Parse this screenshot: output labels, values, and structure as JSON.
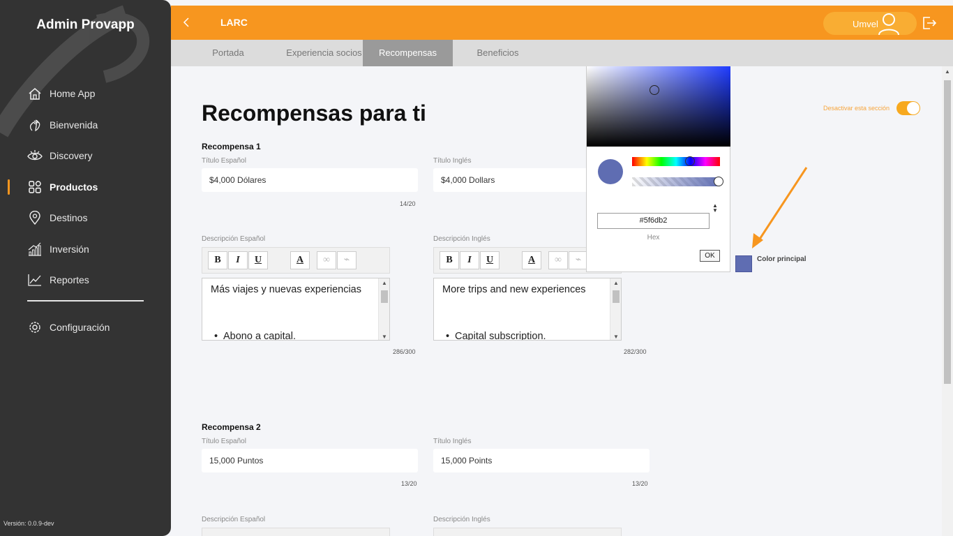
{
  "sidebar": {
    "brand": "Admin Provapp",
    "items": [
      {
        "label": "Home App",
        "icon": "home-icon"
      },
      {
        "label": "Bienvenida",
        "icon": "waving-hand-icon"
      },
      {
        "label": "Discovery",
        "icon": "eye-icon"
      },
      {
        "label": "Productos",
        "icon": "grid-icon",
        "active": true
      },
      {
        "label": "Destinos",
        "icon": "location-pin-icon"
      },
      {
        "label": "Inversión",
        "icon": "bar-growth-icon"
      },
      {
        "label": "Reportes",
        "icon": "line-chart-icon"
      }
    ],
    "config_label": "Configuración",
    "version": "Versión: 0.0.9-dev"
  },
  "header": {
    "title": "LARC",
    "user_name": "Umvel"
  },
  "tabs": [
    {
      "label": "Portada"
    },
    {
      "label": "Experiencia socios"
    },
    {
      "label": "Recompensas",
      "active": true
    },
    {
      "label": "Beneficios"
    }
  ],
  "main": {
    "title": "Recompensas para ti",
    "toggle_label": "Desactivar esta sección",
    "reward1": {
      "title": "Recompensa 1",
      "title_es_label": "Título Español",
      "title_es_value": "$4,000 Dólares",
      "title_es_counter": "14/20",
      "title_en_label": "Título Inglés",
      "title_en_value": "$4,000 Dollars",
      "desc_es_label": "Descripción Español",
      "desc_es_text": "Más viajes y nuevas experiencias",
      "desc_es_bullet": "Abono a capital.",
      "desc_es_counter": "286/300",
      "desc_en_label": "Descripción Inglés",
      "desc_en_text": "More trips and new experiences",
      "desc_en_bullet": "Capital subscription.",
      "desc_en_counter": "282/300"
    },
    "reward2": {
      "title": "Recompensa 2",
      "title_es_label": "Título Español",
      "title_es_value": "15,000 Puntos",
      "title_es_counter": "13/20",
      "title_en_label": "Título Inglés",
      "title_en_value": "15,000 Points",
      "title_en_counter": "13/20",
      "desc_es_label": "Descripción Español",
      "desc_en_label": "Descripción Inglés"
    },
    "toolbar": {
      "bold": "B",
      "italic": "I",
      "underline": "U",
      "color": "A"
    }
  },
  "color_picker": {
    "hex_value": "#5f6db2",
    "hex_label": "Hex",
    "ok_label": "OK",
    "swatch_label": "Color principal",
    "accent": "#f7961f",
    "selected_color": "#5f6db2"
  }
}
